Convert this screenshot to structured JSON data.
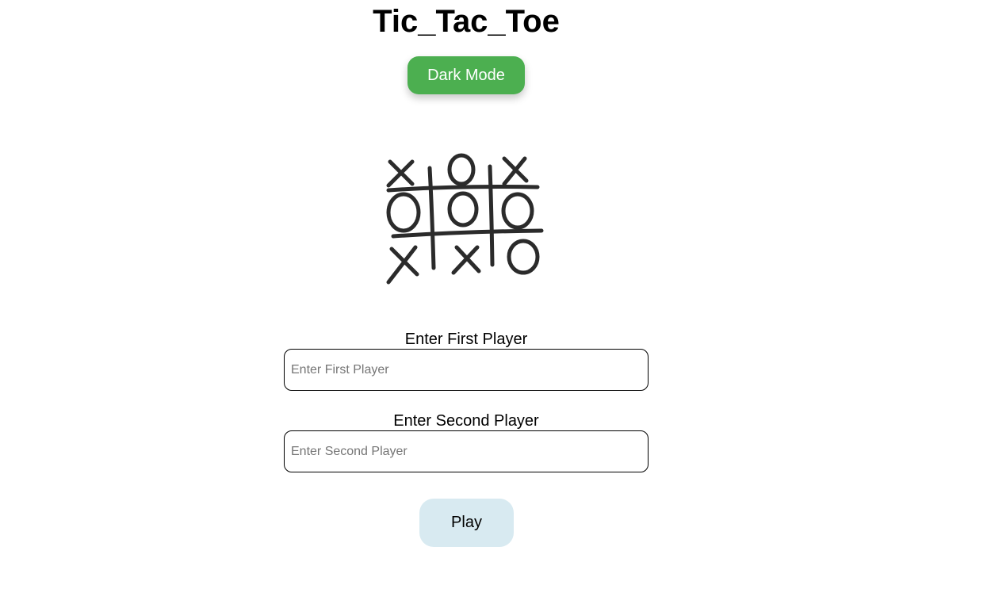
{
  "page": {
    "title": "Tic_Tac_Toe"
  },
  "theme": {
    "dark_mode_button_label": "Dark Mode",
    "dark_mode_button_color": "#4caf50",
    "play_button_color": "#d8eaf1"
  },
  "board_image": {
    "icon": "tic-tac-toe-board-illustration",
    "cells": [
      "X",
      "O",
      "X",
      "O",
      "O",
      "O",
      "X",
      "X",
      "O"
    ]
  },
  "form": {
    "first_player": {
      "label": "Enter First Player",
      "placeholder": "Enter First Player",
      "value": ""
    },
    "second_player": {
      "label": "Enter Second Player",
      "placeholder": "Enter Second Player",
      "value": ""
    },
    "play_button_label": "Play"
  }
}
